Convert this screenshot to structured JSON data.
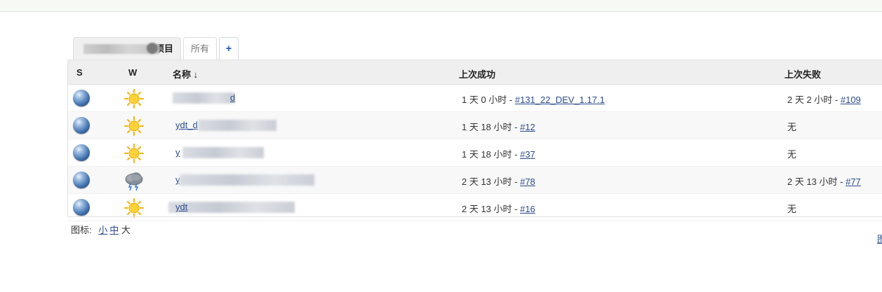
{
  "tabs": {
    "active_label_suffix": "项目",
    "all_label": "所有",
    "add_label": "+"
  },
  "table": {
    "headers": {
      "status": "S",
      "weather": "W",
      "name": "名称 ↓",
      "last_success": "上次成功",
      "last_failure": "上次失败"
    },
    "rows": [
      {
        "name_visible": "d",
        "weather_icon": "sunny-icon",
        "success_prefix": "1 天 0 小时 - ",
        "success_link": "#131_22_DEV_1.17.1",
        "failure_prefix": "2 天 2 小时 - ",
        "failure_link": "#109"
      },
      {
        "name_visible": "ydt_d",
        "weather_icon": "sunny-icon",
        "success_prefix": "1 天 18 小时 - ",
        "success_link": "#12",
        "failure_prefix": "无",
        "failure_link": ""
      },
      {
        "name_visible": "y",
        "weather_icon": "sunny-icon",
        "success_prefix": "1 天 18 小时 - ",
        "success_link": "#37",
        "failure_prefix": "无",
        "failure_link": ""
      },
      {
        "name_visible": "y",
        "weather_icon": "thunderstorm-icon",
        "success_prefix": "2 天 13 小时 - ",
        "success_link": "#78",
        "failure_prefix": "2 天 13 小时 - ",
        "failure_link": "#77"
      },
      {
        "name_visible": "ydt",
        "weather_icon": "sunny-icon",
        "success_prefix": "2 天 13 小时 - ",
        "success_link": "#16",
        "failure_prefix": "无",
        "failure_link": ""
      }
    ]
  },
  "legend": {
    "label": "图标:",
    "small": "小",
    "medium": "中",
    "large": "大"
  },
  "edge_link": "图",
  "colors": {
    "link": "#2a4b8d",
    "header_bg": "#efefef",
    "ball_blue": "#4f7fb9"
  }
}
